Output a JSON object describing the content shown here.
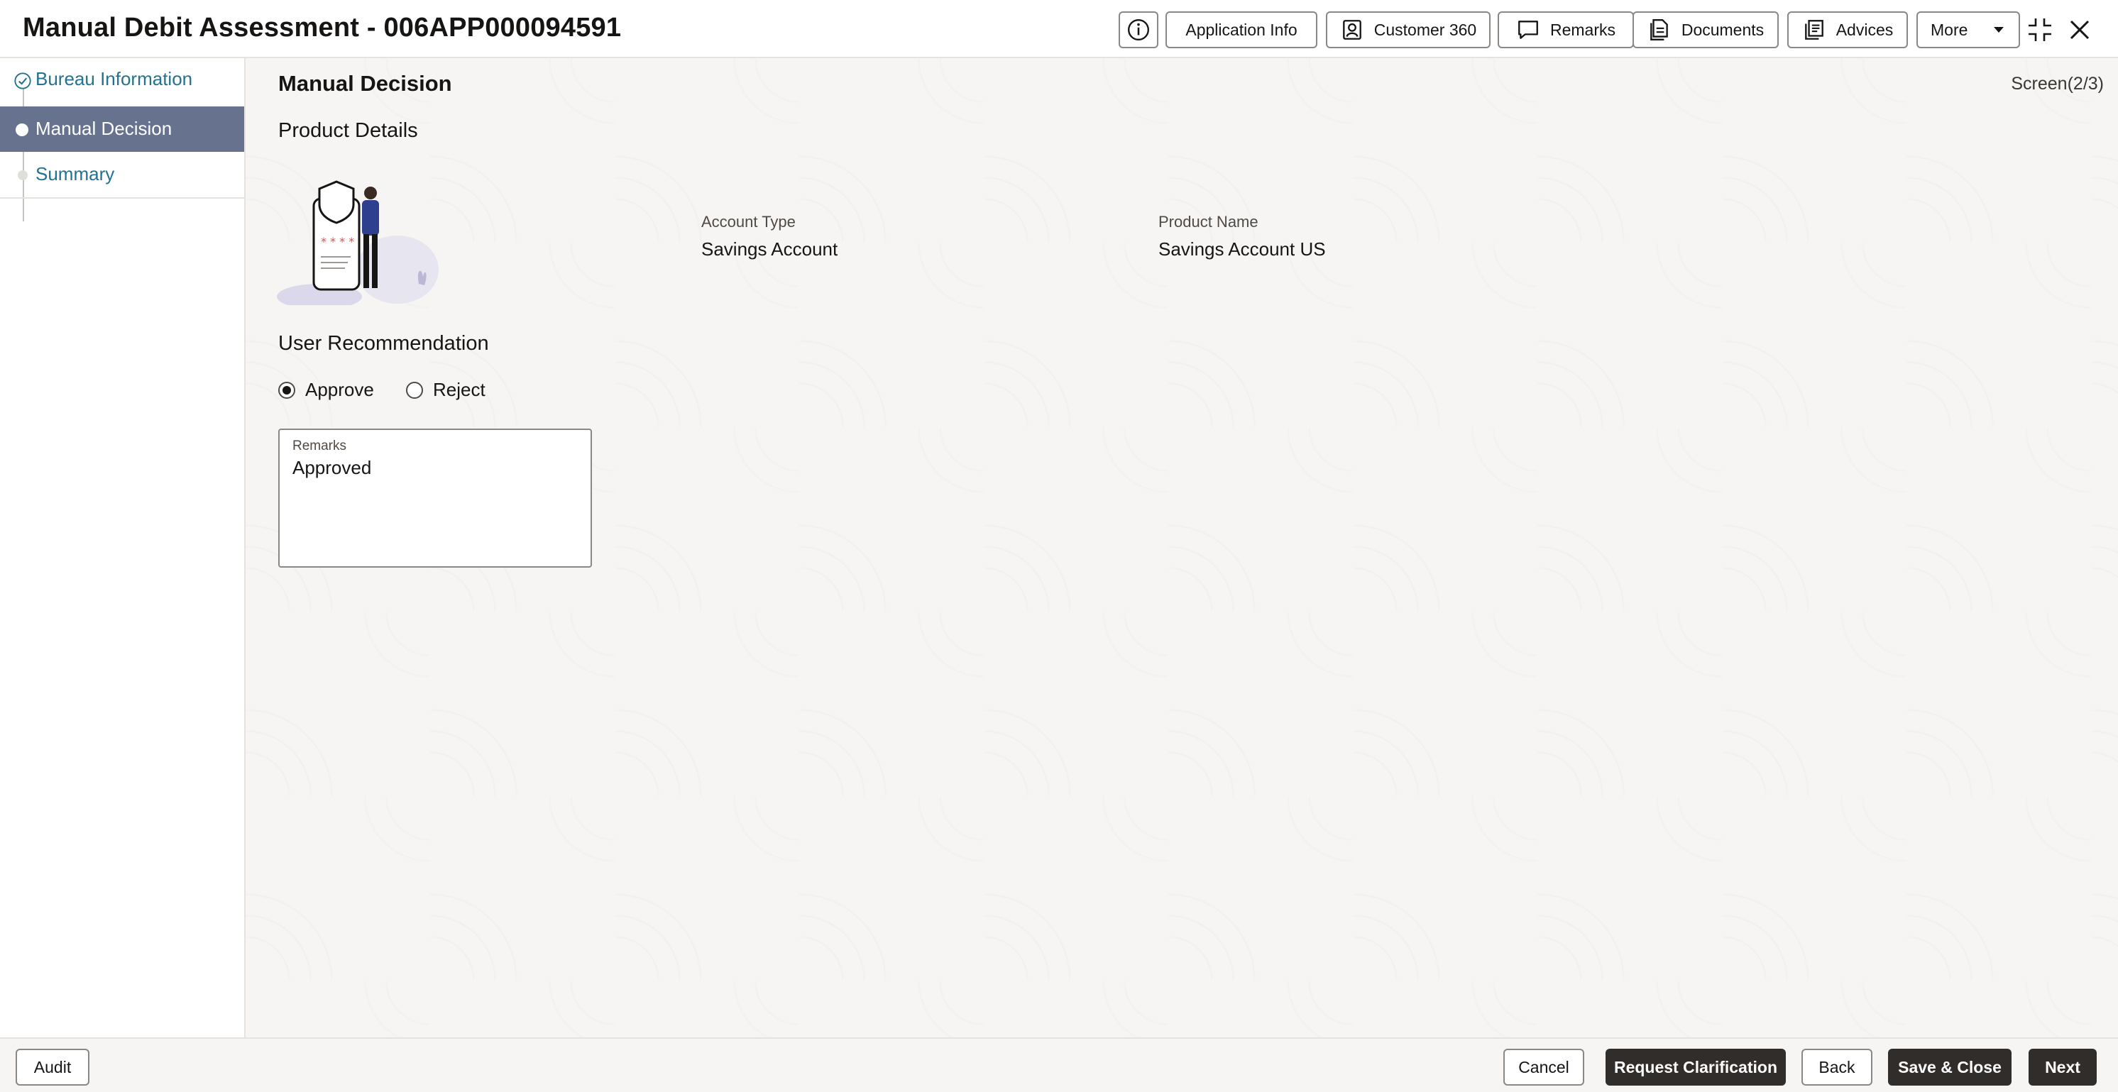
{
  "header": {
    "title": "Manual Debit Assessment - 006APP000094591",
    "buttons": {
      "info_icon": "info-icon",
      "application_info": "Application Info",
      "customer_360": "Customer 360",
      "remarks": "Remarks",
      "documents": "Documents",
      "advices": "Advices",
      "more": "More"
    }
  },
  "sidebar": {
    "items": [
      {
        "label": "Bureau Information",
        "state": "completed"
      },
      {
        "label": "Manual Decision",
        "state": "active"
      },
      {
        "label": "Summary",
        "state": "pending"
      }
    ]
  },
  "main": {
    "section_title": "Manual Decision",
    "screen_indicator": "Screen(2/3)",
    "product_details_title": "Product Details",
    "account_type_label": "Account Type",
    "account_type_value": "Savings Account",
    "product_name_label": "Product Name",
    "product_name_value": "Savings Account US",
    "user_recommendation_title": "User Recommendation",
    "recommendation_options": [
      {
        "label": "Approve",
        "selected": true
      },
      {
        "label": "Reject",
        "selected": false
      }
    ],
    "remarks_label": "Remarks",
    "remarks_value": "Approved"
  },
  "footer": {
    "audit": "Audit",
    "cancel": "Cancel",
    "request_clarification": "Request Clarification",
    "back": "Back",
    "save_close": "Save & Close",
    "next": "Next"
  },
  "colors": {
    "active_nav": "#67728f",
    "link": "#227291",
    "dark_button": "#312d2a"
  }
}
